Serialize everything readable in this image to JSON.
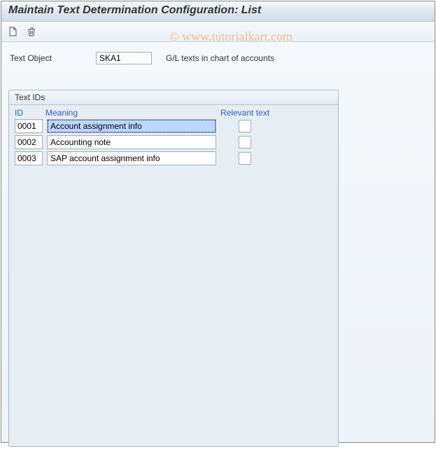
{
  "window": {
    "title": "Maintain Text Determination Configuration: List"
  },
  "toolbar": {
    "newIcon": "new-document-icon",
    "deleteIcon": "trash-icon"
  },
  "form": {
    "textObjectLabel": "Text Object",
    "textObjectValue": "SKA1",
    "textObjectDesc": "G/L texts in chart of accounts"
  },
  "panel": {
    "title": "Text IDs",
    "columns": {
      "id": "ID",
      "meaning": "Meaning",
      "relevant": "Relevant text"
    },
    "rows": [
      {
        "id": "0001",
        "meaning": "Account assignment info",
        "relevant": false,
        "selected": true
      },
      {
        "id": "0002",
        "meaning": "Accounting note",
        "relevant": false,
        "selected": false
      },
      {
        "id": "0003",
        "meaning": "SAP account assignment info",
        "relevant": false,
        "selected": false
      }
    ]
  },
  "watermark": "© www.tutorialkart.com"
}
